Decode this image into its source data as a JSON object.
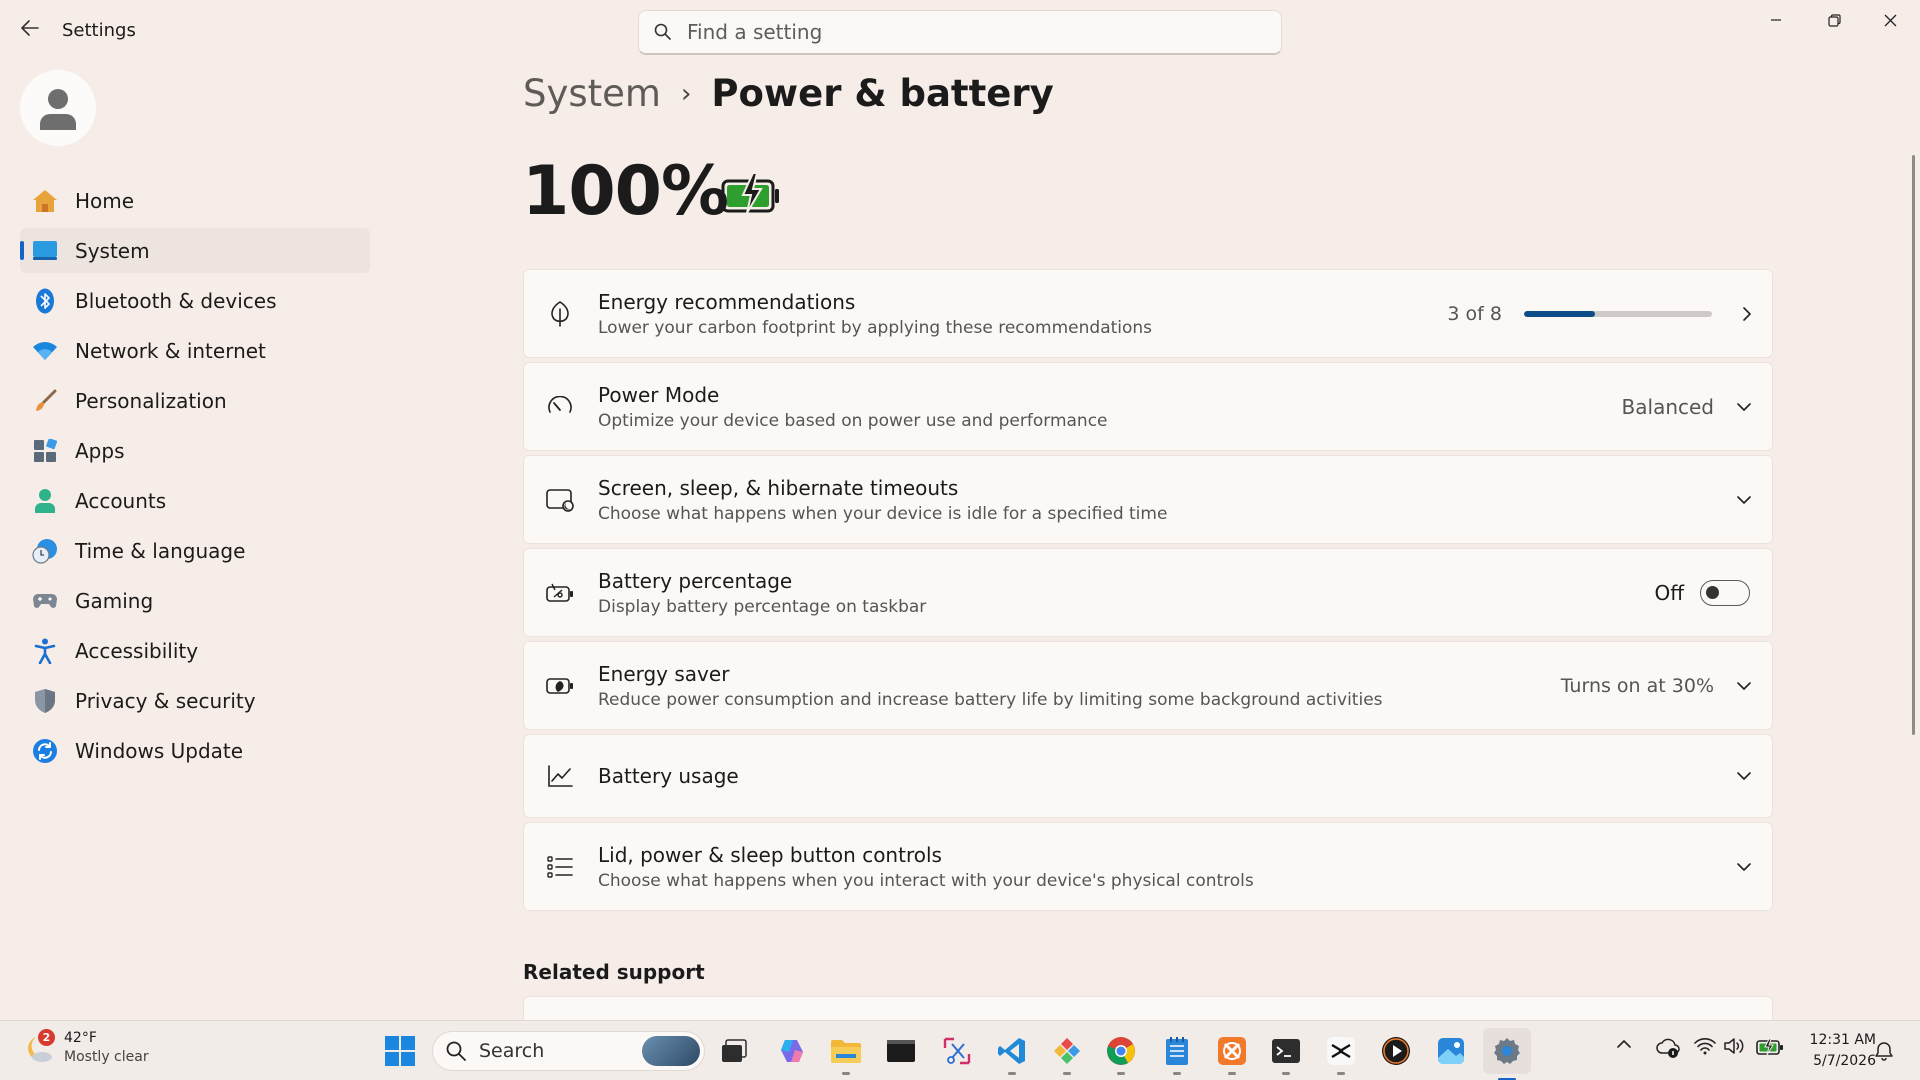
{
  "window": {
    "title": "Settings",
    "search_placeholder": "Find a setting"
  },
  "sidebar": {
    "items": [
      {
        "label": "Home",
        "icon": "home-icon"
      },
      {
        "label": "System",
        "icon": "system-icon",
        "active": true
      },
      {
        "label": "Bluetooth & devices",
        "icon": "bluetooth-icon"
      },
      {
        "label": "Network & internet",
        "icon": "wifi-icon"
      },
      {
        "label": "Personalization",
        "icon": "brush-icon"
      },
      {
        "label": "Apps",
        "icon": "apps-icon"
      },
      {
        "label": "Accounts",
        "icon": "accounts-icon"
      },
      {
        "label": "Time & language",
        "icon": "clock-globe-icon"
      },
      {
        "label": "Gaming",
        "icon": "gamepad-icon"
      },
      {
        "label": "Accessibility",
        "icon": "accessibility-icon"
      },
      {
        "label": "Privacy & security",
        "icon": "shield-icon"
      },
      {
        "label": "Windows Update",
        "icon": "update-icon"
      }
    ]
  },
  "breadcrumb": {
    "parent": "System",
    "separator": "›",
    "current": "Power & battery"
  },
  "battery": {
    "percent_label": "100%",
    "level": 1.0
  },
  "cards": {
    "energy_recommendations": {
      "title": "Energy recommendations",
      "description": "Lower your carbon footprint by applying these recommendations",
      "value": "3 of 8",
      "progress": 0.375
    },
    "power_mode": {
      "title": "Power Mode",
      "description": "Optimize your device based on power use and performance",
      "value": "Balanced"
    },
    "screen_sleep": {
      "title": "Screen, sleep, & hibernate timeouts",
      "description": "Choose what happens when your device is idle for a specified time"
    },
    "battery_percentage": {
      "title": "Battery percentage",
      "description": "Display battery percentage on taskbar",
      "value": "Off",
      "toggle_on": false
    },
    "energy_saver": {
      "title": "Energy saver",
      "description": "Reduce power consumption and increase battery life by limiting some background activities",
      "value": "Turns on at 30%"
    },
    "battery_usage": {
      "title": "Battery usage"
    },
    "lid_power": {
      "title": "Lid, power & sleep button controls",
      "description": "Choose what happens when you interact with your device's physical controls"
    }
  },
  "related_support": {
    "heading": "Related support"
  },
  "taskbar": {
    "weather": {
      "badge": "2",
      "temp": "42°F",
      "condition": "Mostly clear"
    },
    "search_label": "Search",
    "clock": {
      "time": "12:31 AM",
      "date": "5/7/2026"
    }
  },
  "colors": {
    "accent": "#1663c7",
    "progress_fill": "#0f4d8a",
    "battery_green": "#2e9e2e",
    "background": "#f6ede8"
  }
}
